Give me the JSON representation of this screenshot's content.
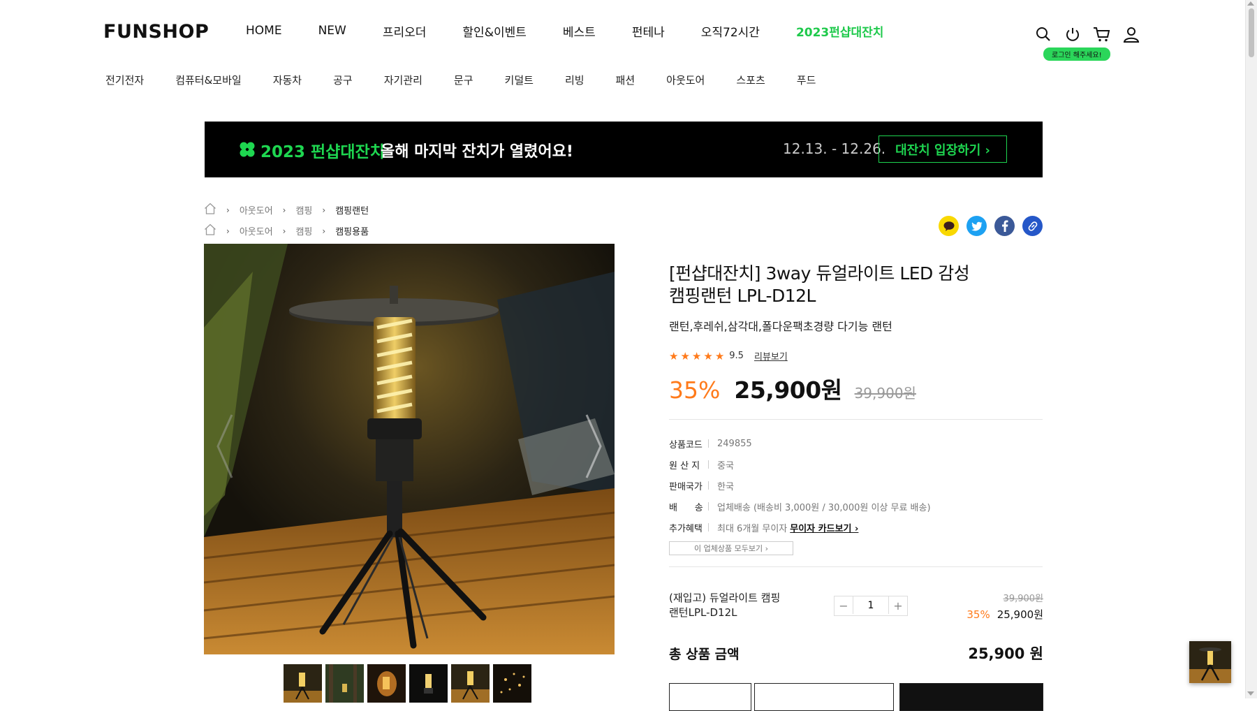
{
  "header": {
    "logo": "FUNSHOP",
    "nav": [
      "HOME",
      "NEW",
      "프리오더",
      "할인&이벤트",
      "베스트",
      "펀테나",
      "오직72시간",
      "2023펀샵대잔치"
    ],
    "login_badge": "로그인 해주세요!",
    "icons": [
      "search-icon",
      "power-icon",
      "cart-icon",
      "user-icon"
    ],
    "accent_color": "#1ec94b"
  },
  "categories": [
    "전기전자",
    "컴퓨터&모바일",
    "자동차",
    "공구",
    "자기관리",
    "문구",
    "키덜트",
    "리빙",
    "패션",
    "아웃도어",
    "스포츠",
    "푸드"
  ],
  "banner": {
    "title": "2023 펀샵대잔치",
    "text": "올해 마지막 잔치가 열렸어요!",
    "dates": "12.13. - 12.26.",
    "button": "대잔치 입장하기 ›"
  },
  "breadcrumbs": [
    [
      "아웃도어",
      "캠핑",
      "캠핑랜턴"
    ],
    [
      "아웃도어",
      "캠핑",
      "캠핑용품"
    ]
  ],
  "share_icons": [
    "kakaotalk-icon",
    "twitter-icon",
    "facebook-icon",
    "link-icon"
  ],
  "product": {
    "title": "[펀샵대잔치] 3way 듀얼라이트 LED 감성 캠핑랜턴 LPL-D12L",
    "subtitle": "랜턴,후레쉬,삼각대,폴다운팩초경량 다기능 랜턴",
    "rating": "9.5",
    "stars": 4.5,
    "review_link": "리뷰보기",
    "discount": "35%",
    "price": "25,900원",
    "original_price": "39,900원",
    "specs": [
      {
        "key": "상품코드",
        "value": "249855"
      },
      {
        "key": "원 산 지",
        "value": "중국"
      },
      {
        "key": "판매국가",
        "value": "한국"
      },
      {
        "key": "배      송",
        "value": "업체배송 (배송비 3,000원 / 30,000원 이상 무료 배송)"
      },
      {
        "key": "추가혜택",
        "value": "최대 6개월 무이자",
        "link": "무이자 카드보기 ›"
      }
    ],
    "all_products_button": "이 업체상품 모두보기  ›"
  },
  "option": {
    "name": "(재입고) 듀얼라이트 캠핑랜턴LPL-D12L",
    "quantity": "1",
    "original_price": "39,900원",
    "discount": "35%",
    "price": "25,900원"
  },
  "total": {
    "label": "총 상품 금액",
    "value": "25,900 원"
  },
  "colors": {
    "discount": "#ff7a1a",
    "banner_green": "#1ed650"
  }
}
